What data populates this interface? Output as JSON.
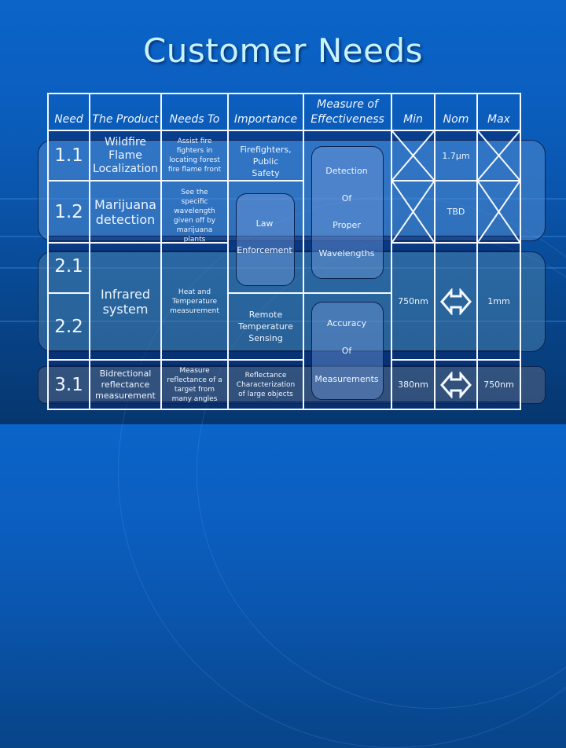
{
  "title": "Customer Needs",
  "table": {
    "headers": {
      "need": "Need",
      "product": "The Product",
      "needs_to": "Needs To",
      "importance": "Importance",
      "measure": "Measure of Effectiveness",
      "min": "Min",
      "nom": "Nom",
      "max": "Max"
    },
    "rows": [
      {
        "need": "1.1",
        "product": "Wildfire Flame Localization",
        "needs_to": "Assist fire fighters in locating forest fire flame front",
        "min": "",
        "nom": "1.7µm",
        "max": ""
      },
      {
        "need": "1.2",
        "product": "Marijuana detection",
        "needs_to": "See the specific wavelength given off by marijuana plants",
        "min": "",
        "nom": "TBD",
        "max": ""
      },
      {
        "need": "2.1"
      },
      {
        "need": "2.2"
      },
      {
        "need": "3.1",
        "product": "Bidrectional reflectance measurement",
        "needs_to": "Measure reflectance of a target from many angles",
        "importance": "Reflectance Characterization of large objects",
        "min": "380nm",
        "nom_icon": "double-arrow-icon",
        "max": "750nm"
      }
    ],
    "group_2": {
      "product": "Infrared system",
      "needs_to": "Heat and Temperature measurement",
      "importance_2_2": "Remote Temperature Sensing",
      "min": "750nm",
      "nom_icon": "double-arrow-icon",
      "max": "1mm"
    },
    "importance_1_1": "Firefighters, Public Safety",
    "importance_law": [
      "Law",
      "Enforcement"
    ],
    "measure_upper": [
      "Detection",
      "Of",
      "Proper",
      "Wavelengths"
    ],
    "measure_lower": [
      "Accuracy",
      "Of",
      "Measurements"
    ]
  }
}
